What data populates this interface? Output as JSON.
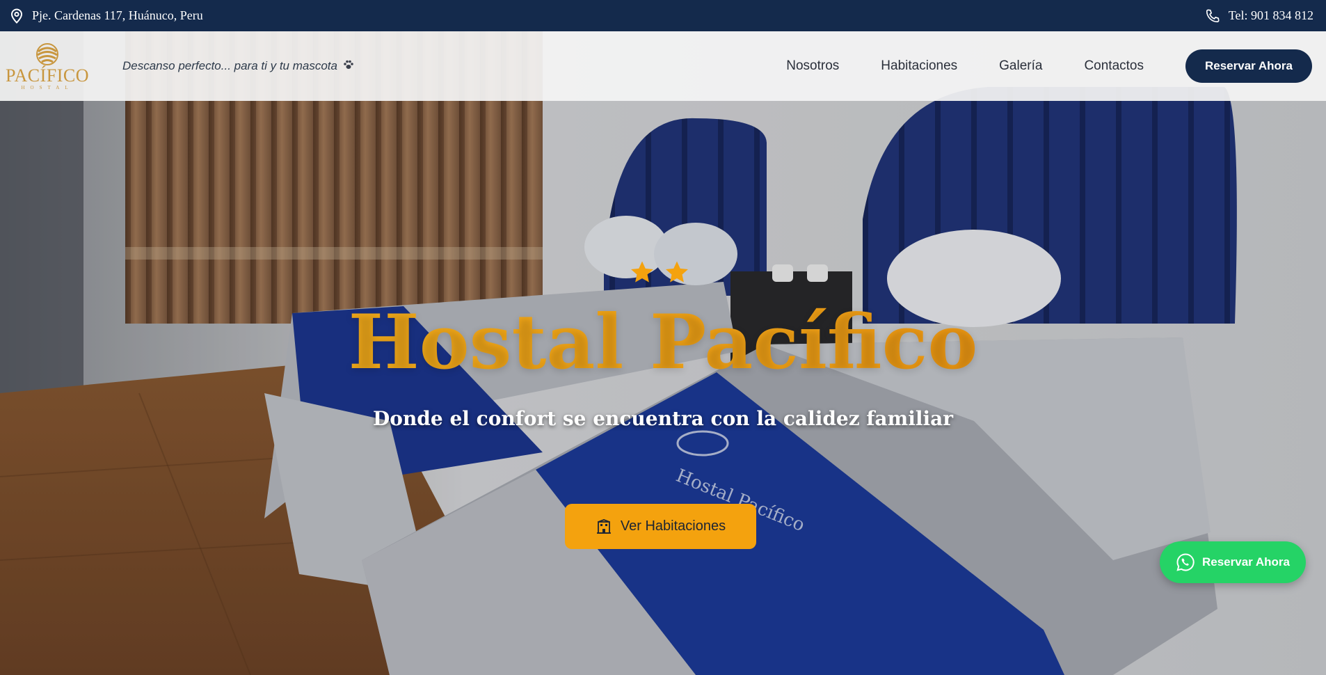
{
  "topbar": {
    "address": "Pje. Cardenas 117, Huánuco, Peru",
    "phone": "Tel: 901 834 812"
  },
  "header": {
    "logo_text": "PACÍFICO",
    "logo_sub": "HOSTAL",
    "tagline": "Descanso perfecto... para ti y tu mascota",
    "nav": [
      "Nosotros",
      "Habitaciones",
      "Galería",
      "Contactos"
    ],
    "reserve_label": "Reservar Ahora"
  },
  "hero": {
    "stars": 2,
    "title": "Hostal Pacífico",
    "subtitle": "Donde el confort se encuentra con la calidez familiar",
    "cta_label": "Ver Habitaciones",
    "bed_print": "Hostal Pacífico"
  },
  "floating": {
    "whatsapp_label": "Reservar Ahora"
  },
  "colors": {
    "navy": "#142a4c",
    "gold": "#f4a20e",
    "whatsapp": "#25d366",
    "logo_gold": "#c8963e"
  }
}
